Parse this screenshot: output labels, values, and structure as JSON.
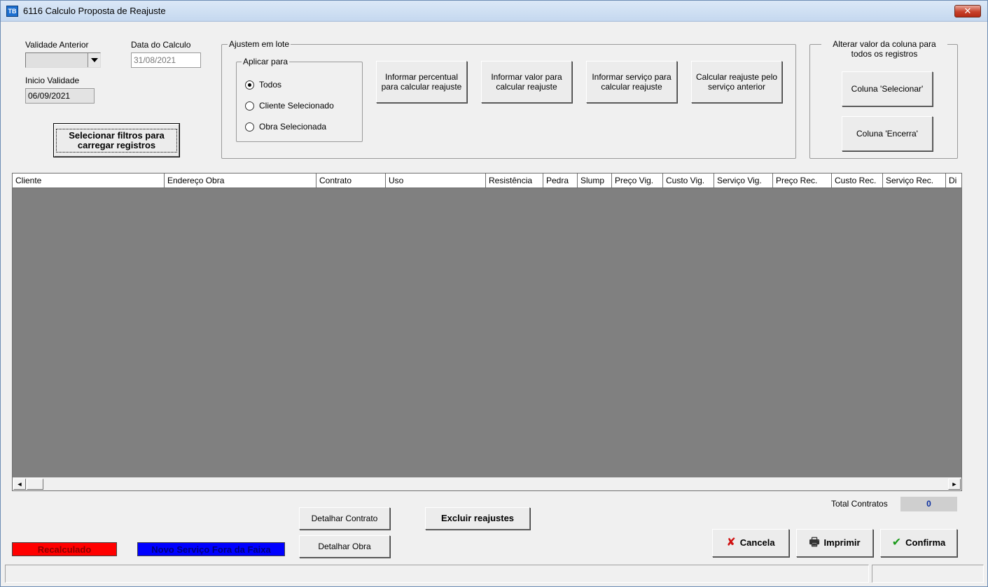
{
  "window": {
    "app_icon": "window-app-icon",
    "title": "6116 Calculo Proposta de Reajuste",
    "close_glyph": "✕"
  },
  "fields": {
    "validade_anterior_label": "Validade Anterior",
    "validade_anterior_value": "",
    "inicio_validade_label": "Inicio Validade",
    "inicio_validade_value": "06/09/2021",
    "data_calculo_label": "Data do Calculo",
    "data_calculo_value": "31/08/2021"
  },
  "buttons": {
    "selecionar_filtros": "Selecionar filtros para carregar registros",
    "informar_percentual": "Informar percentual para calcular reajuste",
    "informar_valor": "Informar valor para calcular reajuste",
    "informar_servico": "Informar serviço para calcular reajuste",
    "calcular_anterior": "Calcular reajuste pelo serviço anterior",
    "coluna_selecionar": "Coluna 'Selecionar'",
    "coluna_encerra": "Coluna 'Encerra'",
    "detalhar_contrato": "Detalhar Contrato",
    "detalhar_obra": "Detalhar Obra",
    "excluir_reajustes": "Excluir reajustes",
    "cancela": "Cancela",
    "imprimir": "Imprimir",
    "confirma": "Confirma"
  },
  "batch": {
    "group_title": "Ajustem em lote",
    "apply_title": "Aplicar para",
    "options": [
      "Todos",
      "Cliente Selecionado",
      "Obra Selecionada"
    ],
    "selected": "Todos"
  },
  "alter_group": {
    "title": "Alterar valor da coluna para todos os registros"
  },
  "grid": {
    "columns": [
      "Cliente",
      "Endereço Obra",
      "Contrato",
      "Uso",
      "Resistência",
      "Pedra",
      "Slump",
      "Preço Vig.",
      "Custo Vig.",
      "Serviço Vig.",
      "Preço Rec.",
      "Custo Rec.",
      "Serviço Rec.",
      "Di"
    ],
    "scroll_left": "◄",
    "scroll_right": "►"
  },
  "totals": {
    "label": "Total Contratos",
    "value": "0"
  },
  "legend": {
    "recalculado": "Recalculado",
    "recalculado_bg": "#ff0000",
    "recalculado_fg": "#8b0000",
    "novo_servico": "Novo Serviço Fora da Faixa",
    "novo_servico_bg": "#0000ff",
    "novo_servico_fg": "#00007a"
  },
  "icons": {
    "cancela": "✘",
    "imprimir": "🖶",
    "confirma": "✔"
  }
}
